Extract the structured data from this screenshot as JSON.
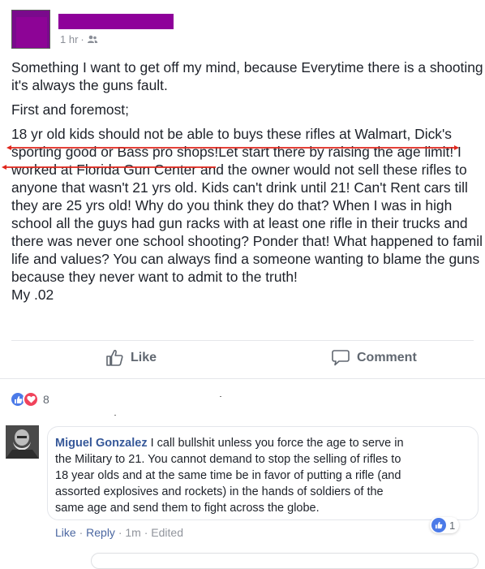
{
  "post": {
    "author_redacted": true,
    "time": "1 hr",
    "separator": "·",
    "privacy_icon": "friends-icon",
    "lines": [
      "Something I want to get off my mind, because Everytime there is a shooting",
      "it's always the guns fault.",
      "",
      "First and foremost;",
      "",
      "18 yr old kids should not be able to buys these rifles at Walmart, Dick's",
      "sporting good or Bass pro shops!Let start there by raising the age limit! I",
      "worked at Florida Gun Center and the owner would not sell these rifles to",
      "anyone that wasn't 21 yrs old. Kids can't drink until 21! Can't Rent cars till",
      "they are 25 yrs old! Why do you think they do that? When I was in high",
      "school all the guys had gun racks with at least one rifle in their trucks and",
      "there was never one school shooting? Ponder that! What happened to famil",
      "life and values? You can always find a someone wanting to blame the guns",
      "because they never want to admit to the truth!",
      "My .02"
    ]
  },
  "actions": {
    "like_label": "Like",
    "comment_label": "Comment"
  },
  "reactions": {
    "types": [
      "like",
      "love"
    ],
    "count": "8"
  },
  "comment": {
    "author": "Miguel Gonzalez",
    "text_first": " I call bullshit unless you force the age to serve in",
    "text_lines": [
      "the Military to 21. You cannot demand to stop the selling of rifles to",
      "18 year olds and at the same time be in favor of putting a rifle (and",
      "assorted explosives and rockets) in the hands of soldiers of the",
      "same age and send them to fight across the globe."
    ],
    "like_count": "1",
    "like_label": "Like",
    "reply_label": "Reply",
    "time": "1m",
    "edited": "Edited",
    "dot": "·"
  },
  "colors": {
    "redaction": "#8e009a",
    "underline": "#e0261c",
    "link": "#365899",
    "like_blue": "#4b7ae8",
    "love_red": "#f0435b"
  }
}
